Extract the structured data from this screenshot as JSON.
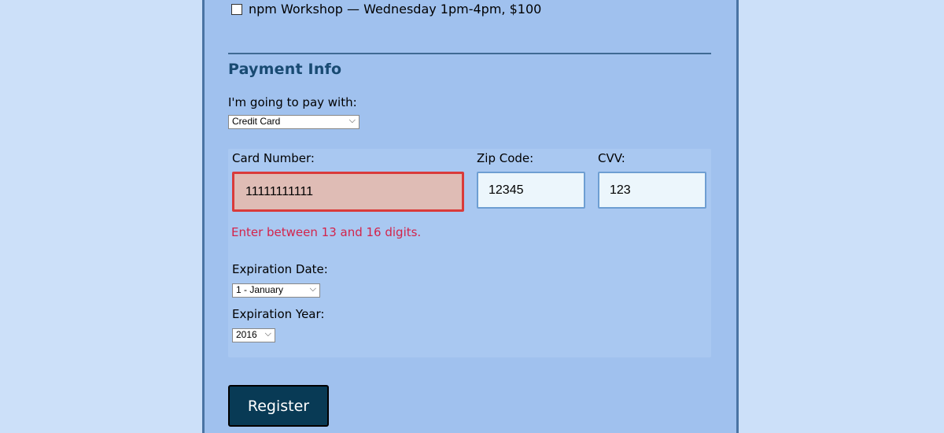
{
  "activities": {
    "npm_workshop_label": "npm Workshop — Wednesday 1pm-4pm, $100"
  },
  "payment": {
    "title": "Payment Info",
    "pay_with_label": "I'm going to pay with:",
    "pay_with_value": "Credit Card",
    "card_number_label": "Card Number:",
    "card_number_value": "11111111111",
    "card_number_error": "Enter between 13 and 16 digits.",
    "zip_label": "Zip Code:",
    "zip_value": "12345",
    "cvv_label": "CVV:",
    "cvv_value": "123",
    "exp_date_label": "Expiration Date:",
    "exp_date_value": "1 - January",
    "exp_year_label": "Expiration Year:",
    "exp_year_value": "2016"
  },
  "register_label": "Register",
  "colors": {
    "page_bg": "#cce0f9",
    "form_bg": "#a0c1ee",
    "heading": "#184a72",
    "error_text": "#d3244b",
    "error_border": "#d93b3b",
    "button_bg": "#083a55"
  }
}
